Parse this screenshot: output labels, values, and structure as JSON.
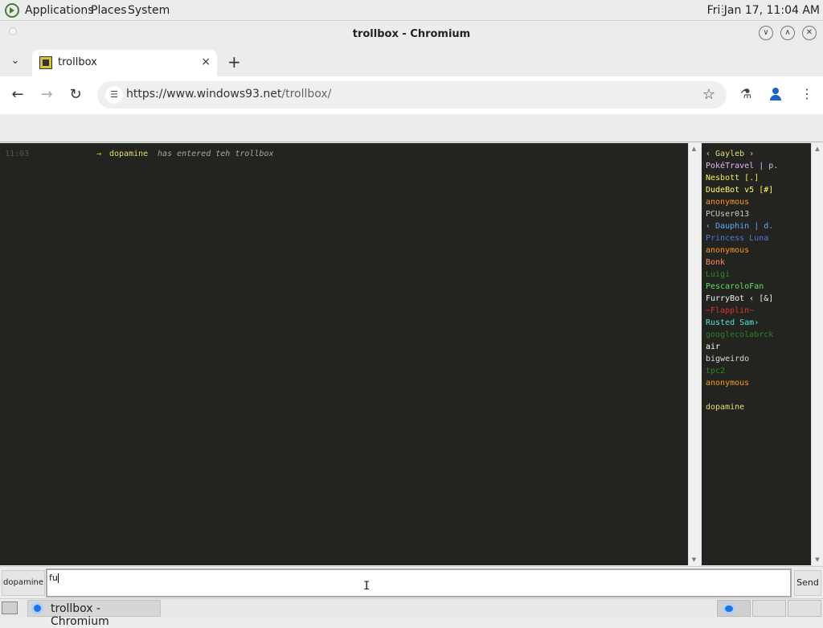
{
  "top_panel": {
    "menus": [
      "Applications",
      "Places",
      "System"
    ],
    "clock": "Fri Jan 17, 11:04 AM"
  },
  "window": {
    "title": "trollbox - Chromium"
  },
  "tab": {
    "title": "trollbox",
    "close_icon": "×",
    "new_tab_icon": "+"
  },
  "toolbar": {
    "url_host": "https://www.windows93.net",
    "url_path": "/trollbox/"
  },
  "chat": {
    "messages": [
      {
        "time": "11:03",
        "arrow": "→",
        "user": "dopamine",
        "text": "has entered teh trollbox"
      }
    ]
  },
  "users": [
    {
      "name": "‹ Gayleb ›",
      "color": "#e6db74"
    },
    {
      "name": "PokéTravel | p.",
      "color": "#e8b0ff"
    },
    {
      "name": "Nesbott [.]",
      "color": "#f0f060"
    },
    {
      "name": "DudeBot v5 [#]",
      "color": "#ffff66"
    },
    {
      "name": "anonymous",
      "color": "#fd971f"
    },
    {
      "name": "PCUser013",
      "color": "#c8c8c8"
    },
    {
      "name": "‹ Dauphin | d.",
      "color": "#66aaff"
    },
    {
      "name": "Princess Luna",
      "color": "#4b7bdc"
    },
    {
      "name": "anonymous",
      "color": "#fd971f"
    },
    {
      "name": "Bonk",
      "color": "#ff8c5a"
    },
    {
      "name": "Luigi",
      "color": "#2a8a2a"
    },
    {
      "name": "PescaroloFan",
      "color": "#5ae05a"
    },
    {
      "name": "FurryBot ‹ [&]",
      "color": "#f0f0f0"
    },
    {
      "name": "~Flapplin~",
      "color": "#e03030"
    },
    {
      "name": "Rusted Sam›",
      "color": "#55e0e0"
    },
    {
      "name": "googlecolabrck",
      "color": "#2e7d2e"
    },
    {
      "name": "air",
      "color": "#ffffff"
    },
    {
      "name": "bigweirdo",
      "color": "#d8d8d8"
    },
    {
      "name": "tpc2",
      "color": "#2a8a2a"
    },
    {
      "name": "anonymous",
      "color": "#fd971f"
    },
    {
      "name": "",
      "color": "#ffffff"
    },
    {
      "name": "dopamine",
      "color": "#e6db74"
    }
  ],
  "input": {
    "nick_button": "dopamine",
    "value": "fu",
    "send_button": "Send"
  },
  "taskbar": {
    "task_label": "trollbox - Chromium"
  }
}
